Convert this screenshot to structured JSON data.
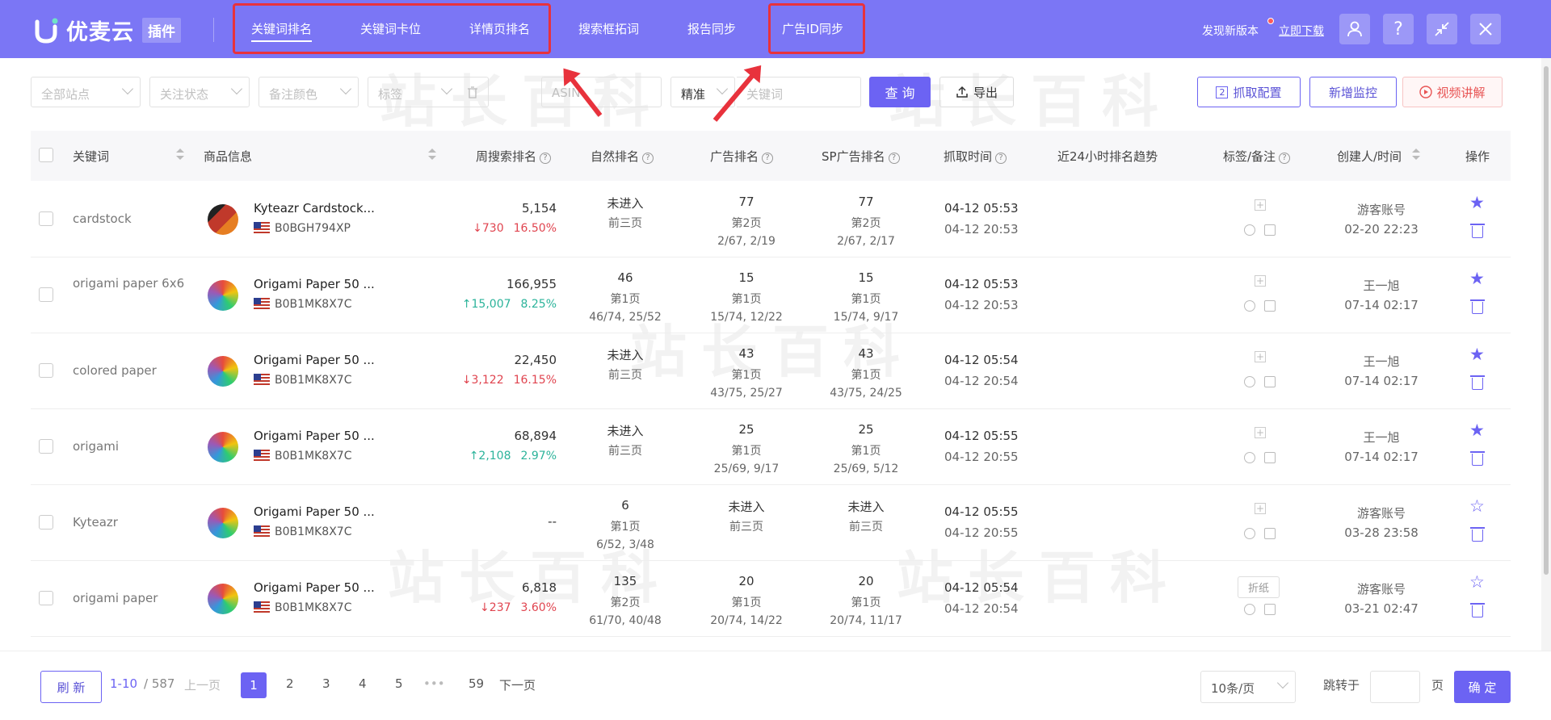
{
  "header": {
    "logo_text": "优麦云",
    "logo_badge": "插件",
    "nav": [
      "关键词排名",
      "关键词卡位",
      "详情页排名",
      "搜索框拓词",
      "报告同步",
      "广告ID同步"
    ],
    "new_version": "发现新版本",
    "download": "立即下载",
    "buttons": [
      "user-icon",
      "help-icon",
      "collapse-icon",
      "close-icon"
    ]
  },
  "toolbar": {
    "site": "全部站点",
    "follow": "关注状态",
    "note_color": "备注颜色",
    "tag": "标签",
    "asin_placeholder": "ASIN",
    "match": "精准",
    "keyword_placeholder": "关键词",
    "query": "查 询",
    "export": "导出",
    "fetch_config_num": "2",
    "fetch_config": "抓取配置",
    "add_monitor": "新增监控",
    "video": "视频讲解"
  },
  "table": {
    "headers": {
      "keyword": "关键词",
      "product": "商品信息",
      "weekly": "周搜索排名",
      "organic": "自然排名",
      "ad": "广告排名",
      "sp": "SP广告排名",
      "fetch": "抓取时间",
      "trend": "近24小时排名趋势",
      "tag": "标签/备注",
      "creator": "创建人/时间",
      "ops": "操作"
    },
    "rows": [
      {
        "keyword": "cardstock",
        "title": "Kyteazr Cardstock...",
        "asin": "B0BGH794XP",
        "weekly": "5,154",
        "dir": "down",
        "change": "730",
        "pct": "16.50%",
        "org1": "未进入",
        "org2": "前三页",
        "org3": "",
        "ad1": "77",
        "ad2": "第2页",
        "ad3": "2/67, 2/19",
        "sp1": "77",
        "sp2": "第2页",
        "sp3": "2/67, 2/17",
        "t1": "04-12 05:53",
        "t2": "04-12 20:53",
        "tag": "",
        "creator": "游客账号",
        "ctime": "02-20 22:23",
        "starred": true
      },
      {
        "keyword": "origami paper 6x6",
        "title": "Origami Paper 50 ...",
        "asin": "B0B1MK8X7C",
        "weekly": "166,955",
        "dir": "up",
        "change": "15,007",
        "pct": "8.25%",
        "org1": "46",
        "org2": "第1页",
        "org3": "46/74, 25/52",
        "ad1": "15",
        "ad2": "第1页",
        "ad3": "15/74, 12/22",
        "sp1": "15",
        "sp2": "第1页",
        "sp3": "15/74, 9/17",
        "t1": "04-12 05:53",
        "t2": "04-12 20:53",
        "tag": "",
        "creator": "王一旭",
        "ctime": "07-14 02:17",
        "starred": true
      },
      {
        "keyword": "colored paper",
        "title": "Origami Paper 50 ...",
        "asin": "B0B1MK8X7C",
        "weekly": "22,450",
        "dir": "down",
        "change": "3,122",
        "pct": "16.15%",
        "org1": "未进入",
        "org2": "前三页",
        "org3": "",
        "ad1": "43",
        "ad2": "第1页",
        "ad3": "43/75, 25/27",
        "sp1": "43",
        "sp2": "第1页",
        "sp3": "43/75, 24/25",
        "t1": "04-12 05:54",
        "t2": "04-12 20:54",
        "tag": "",
        "creator": "王一旭",
        "ctime": "07-14 02:17",
        "starred": true
      },
      {
        "keyword": "origami",
        "title": "Origami Paper 50 ...",
        "asin": "B0B1MK8X7C",
        "weekly": "68,894",
        "dir": "up",
        "change": "2,108",
        "pct": "2.97%",
        "org1": "未进入",
        "org2": "前三页",
        "org3": "",
        "ad1": "25",
        "ad2": "第1页",
        "ad3": "25/69, 9/17",
        "sp1": "25",
        "sp2": "第1页",
        "sp3": "25/69, 5/12",
        "t1": "04-12 05:55",
        "t2": "04-12 20:55",
        "tag": "",
        "creator": "王一旭",
        "ctime": "07-14 02:17",
        "starred": true
      },
      {
        "keyword": "Kyteazr",
        "title": "Origami Paper 50 ...",
        "asin": "B0B1MK8X7C",
        "weekly": "--",
        "dir": "none",
        "change": "",
        "pct": "",
        "org1": "6",
        "org2": "第1页",
        "org3": "6/52, 3/48",
        "ad1": "未进入",
        "ad2": "前三页",
        "ad3": "",
        "sp1": "未进入",
        "sp2": "前三页",
        "sp3": "",
        "t1": "04-12 05:55",
        "t2": "04-12 20:55",
        "tag": "",
        "creator": "游客账号",
        "ctime": "03-28 23:58",
        "starred": false
      },
      {
        "keyword": "origami paper",
        "title": "Origami Paper 50 ...",
        "asin": "B0B1MK8X7C",
        "weekly": "6,818",
        "dir": "down",
        "change": "237",
        "pct": "3.60%",
        "org1": "135",
        "org2": "第2页",
        "org3": "61/70, 40/48",
        "ad1": "20",
        "ad2": "第1页",
        "ad3": "20/74, 14/22",
        "sp1": "20",
        "sp2": "第1页",
        "sp3": "20/74, 11/17",
        "t1": "04-12 05:54",
        "t2": "04-12 20:54",
        "tag": "折纸",
        "creator": "游客账号",
        "ctime": "03-21 02:47",
        "starred": false
      }
    ]
  },
  "footer": {
    "refresh": "刷 新",
    "range": "1-10",
    "total": "/ 587",
    "prev": "上一页",
    "pages": [
      "1",
      "2",
      "3",
      "4",
      "5"
    ],
    "ellipsis": "•••",
    "last": "59",
    "next": "下一页",
    "per_page": "10条/页",
    "jump_label": "跳转于",
    "page_unit": "页",
    "confirm": "确 定"
  },
  "colors": {
    "header": "#7b76f5",
    "primary": "#6c63f3",
    "highlight": "#e8323c",
    "down": "#e0444f",
    "up": "#2bb39a"
  }
}
